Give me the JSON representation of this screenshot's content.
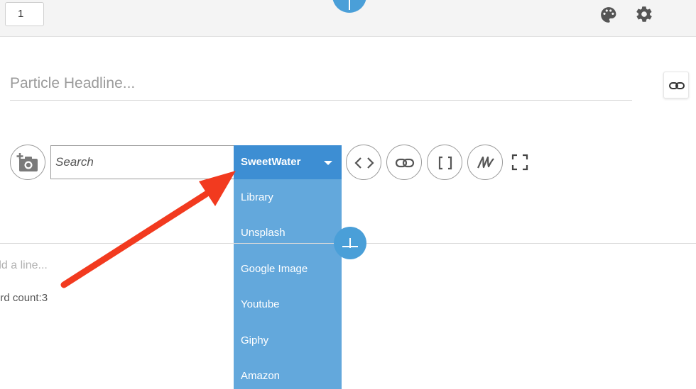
{
  "topbar": {
    "page_number": "1"
  },
  "editor": {
    "headline_placeholder": "Particle Headline...",
    "add_line_placeholder": "dd a line...",
    "word_count": "ord count:3"
  },
  "media_toolbar": {
    "search_placeholder": "Search",
    "selected_source": "SweetWater",
    "sources": [
      "Library",
      "Unsplash",
      "Google Image",
      "Youtube",
      "Giphy",
      "Amazon"
    ]
  },
  "icons": {
    "palette": "palette-icon",
    "gear": "gear-icon",
    "link": "link-icon",
    "camera": "add-photo-icon",
    "code": "code-icon",
    "brackets": "brackets-icon",
    "wave": "signature-icon",
    "fullscreen": "fullscreen-icon"
  },
  "colors": {
    "accent": "#4a9fd8",
    "select_bg": "#3d8ed3",
    "dropdown_bg": "#63a8dc",
    "annotation_arrow": "#f23a1f"
  }
}
